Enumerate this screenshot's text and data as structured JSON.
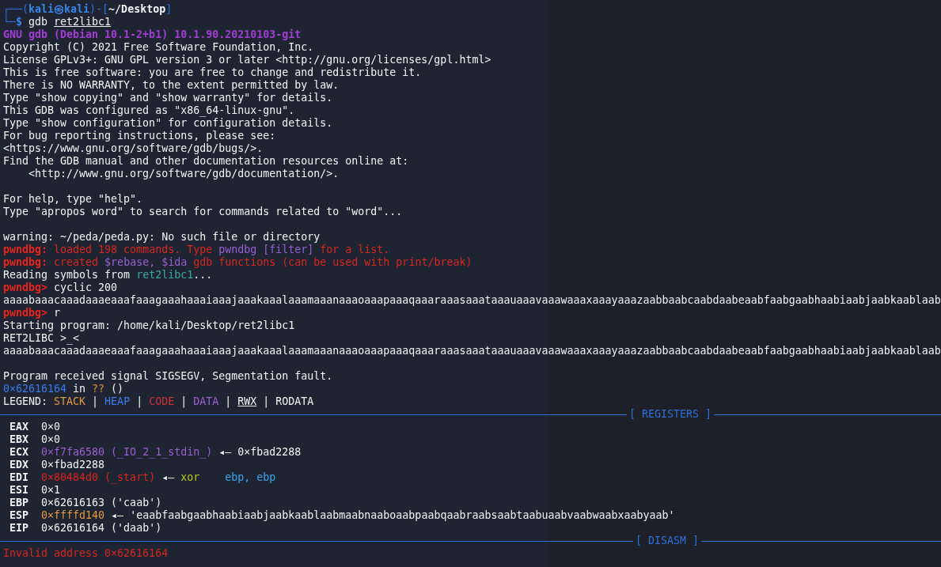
{
  "terminal": {
    "lines": [
      {
        "kind": "text",
        "segments": [
          {
            "text": "┌──(",
            "color": "#2f6fd6",
            "kind": "plain"
          },
          {
            "text": "kali㉿kali",
            "color": "#3a86e8",
            "kind": "bold"
          },
          {
            "text": ")-[",
            "color": "#2f6fd6",
            "kind": "plain"
          },
          {
            "text": "~/Desktop",
            "kind": "bold"
          },
          {
            "text": "]",
            "color": "#2f6fd6",
            "kind": "plain"
          }
        ]
      },
      {
        "kind": "text",
        "segments": [
          {
            "text": "└─",
            "color": "#2f6fd6",
            "kind": "plain"
          },
          {
            "text": "$",
            "color": "#3a86e8",
            "kind": "bold"
          },
          {
            "text": " gdb ",
            "kind": "plain"
          },
          {
            "text": "ret2libc1",
            "kind": "underlined"
          }
        ]
      },
      {
        "kind": "text",
        "segments": [
          {
            "text": "GNU gdb (Debian 10.1-2+b1) 10.1.90.20210103-git",
            "color": "#a13ed3",
            "kind": "bold"
          }
        ]
      },
      {
        "kind": "text",
        "segments": [
          {
            "text": "Copyright (C) 2021 Free Software Foundation, Inc.",
            "kind": "plain"
          }
        ]
      },
      {
        "kind": "text",
        "segments": [
          {
            "text": "License GPLv3+: GNU GPL version 3 or later <http://gnu.org/licenses/gpl.html>",
            "kind": "plain"
          }
        ]
      },
      {
        "kind": "text",
        "segments": [
          {
            "text": "This is free software: you are free to change and redistribute it.",
            "kind": "plain"
          }
        ]
      },
      {
        "kind": "text",
        "segments": [
          {
            "text": "There is NO WARRANTY, to the extent permitted by law.",
            "kind": "plain"
          }
        ]
      },
      {
        "kind": "text",
        "segments": [
          {
            "text": "Type \"show copying\" and \"show warranty\" for details.",
            "kind": "plain"
          }
        ]
      },
      {
        "kind": "text",
        "segments": [
          {
            "text": "This GDB was configured as \"x86_64-linux-gnu\".",
            "kind": "plain"
          }
        ]
      },
      {
        "kind": "text",
        "segments": [
          {
            "text": "Type \"show configuration\" for configuration details.",
            "kind": "plain"
          }
        ]
      },
      {
        "kind": "text",
        "segments": [
          {
            "text": "For bug reporting instructions, please see:",
            "kind": "plain"
          }
        ]
      },
      {
        "kind": "text",
        "segments": [
          {
            "text": "<https://www.gnu.org/software/gdb/bugs/>.",
            "kind": "plain"
          }
        ]
      },
      {
        "kind": "text",
        "segments": [
          {
            "text": "Find the GDB manual and other documentation resources online at:",
            "kind": "plain"
          }
        ]
      },
      {
        "kind": "text",
        "segments": [
          {
            "text": "    <http://www.gnu.org/software/gdb/documentation/>.",
            "kind": "plain"
          }
        ]
      },
      {
        "kind": "blank"
      },
      {
        "kind": "text",
        "segments": [
          {
            "text": "For help, type \"help\".",
            "kind": "plain"
          }
        ]
      },
      {
        "kind": "text",
        "segments": [
          {
            "text": "Type \"apropos word\" to search for commands related to \"word\"...",
            "kind": "plain"
          }
        ]
      },
      {
        "kind": "blank"
      },
      {
        "kind": "text",
        "segments": [
          {
            "text": "warning: ~/peda/peda.py: No such file or directory",
            "kind": "plain"
          }
        ]
      },
      {
        "kind": "text",
        "segments": [
          {
            "text": "pwndbg:",
            "color": "#e5251d",
            "kind": "bold"
          },
          {
            "text": " loaded 198 commands. Type ",
            "color": "#d8261f",
            "kind": "plain"
          },
          {
            "text": "pwndbg [filter]",
            "color": "#9a5fd0",
            "kind": "plain"
          },
          {
            "text": " for a list.",
            "color": "#d8261f",
            "kind": "plain"
          }
        ]
      },
      {
        "kind": "text",
        "segments": [
          {
            "text": "pwndbg:",
            "color": "#e5251d",
            "kind": "bold"
          },
          {
            "text": " created ",
            "color": "#d8261f",
            "kind": "plain"
          },
          {
            "text": "$rebase, $ida",
            "color": "#9a5fd0",
            "kind": "plain"
          },
          {
            "text": " gdb functions (can be used with print/break)",
            "color": "#d8261f",
            "kind": "plain"
          }
        ]
      },
      {
        "kind": "text",
        "segments": [
          {
            "text": "Reading symbols from ",
            "kind": "plain"
          },
          {
            "text": "ret2libc1",
            "color": "#3aa89e",
            "kind": "plain"
          },
          {
            "text": "...",
            "kind": "plain"
          }
        ]
      },
      {
        "kind": "text",
        "segments": [
          {
            "text": "pwndbg>",
            "color": "#e5251d",
            "kind": "bold"
          },
          {
            "text": " cyclic 200",
            "kind": "plain"
          }
        ]
      },
      {
        "kind": "text",
        "segments": [
          {
            "text": "aaaabaaacaaadaaaeaaafaaagaaahaaaiaaajaaakaaalaaamaaanaaaoaaapaaaqaaaraaasaaataaauaaavaaawaaaxaaayaaazaabbaabcaabdaabeaabfaabgaabhaabiaabjaabkaablaab",
            "kind": "plain"
          }
        ]
      },
      {
        "kind": "text",
        "segments": [
          {
            "text": "pwndbg>",
            "color": "#e5251d",
            "kind": "bold"
          },
          {
            "text": " r",
            "kind": "plain"
          }
        ]
      },
      {
        "kind": "text",
        "segments": [
          {
            "text": "Starting program: /home/kali/Desktop/ret2libc1",
            "kind": "plain"
          }
        ]
      },
      {
        "kind": "text",
        "segments": [
          {
            "text": "RET2LIBC >_<",
            "kind": "plain"
          }
        ]
      },
      {
        "kind": "text",
        "segments": [
          {
            "text": "aaaabaaacaaadaaaeaaafaaagaaahaaaiaaajaaakaaalaaamaaanaaaoaaapaaaqaaaraaasaaataaauaaavaaawaaaxaaayaaazaabbaabcaabdaabeaabfaabgaabhaabiaabjaabkaablaab",
            "kind": "plain"
          }
        ]
      },
      {
        "kind": "blank"
      },
      {
        "kind": "text",
        "segments": [
          {
            "text": "Program received signal SIGSEGV, Segmentation fault.",
            "kind": "plain"
          }
        ]
      },
      {
        "kind": "text",
        "segments": [
          {
            "text": "0×62616164",
            "color": "#3b7be8",
            "kind": "plain"
          },
          {
            "text": " in ",
            "kind": "plain"
          },
          {
            "text": "??",
            "color": "#d9912f",
            "kind": "plain"
          },
          {
            "text": " ()",
            "kind": "plain"
          }
        ]
      },
      {
        "kind": "text",
        "segments": [
          {
            "text": "LEGEND: ",
            "kind": "plain"
          },
          {
            "text": "STACK",
            "color": "#e39a3b",
            "kind": "plain"
          },
          {
            "text": " | ",
            "kind": "plain"
          },
          {
            "text": "HEAP",
            "color": "#3b7be8",
            "kind": "plain"
          },
          {
            "text": " | ",
            "kind": "plain"
          },
          {
            "text": "CODE",
            "color": "#cc3333",
            "kind": "plain"
          },
          {
            "text": " | ",
            "kind": "plain"
          },
          {
            "text": "DATA",
            "color": "#9a5fd0",
            "kind": "plain"
          },
          {
            "text": " | ",
            "kind": "plain"
          },
          {
            "text": "RWX",
            "kind": "underlined"
          },
          {
            "text": " | RODATA",
            "kind": "plain"
          }
        ]
      },
      {
        "kind": "separator",
        "label": "[ REGISTERS ]"
      },
      {
        "kind": "text",
        "segments": [
          {
            "text": " EAX  ",
            "kind": "bold"
          },
          {
            "text": "0×0",
            "kind": "plain"
          }
        ]
      },
      {
        "kind": "text",
        "segments": [
          {
            "text": " EBX  ",
            "kind": "bold"
          },
          {
            "text": "0×0",
            "kind": "plain"
          }
        ]
      },
      {
        "kind": "text",
        "segments": [
          {
            "text": " ECX  ",
            "kind": "bold"
          },
          {
            "text": "0×f7fa6580 (_IO_2_1_stdin_)",
            "color": "#9a5fd0",
            "kind": "plain"
          },
          {
            "text": " ◂— 0×fbad2288",
            "kind": "plain"
          }
        ]
      },
      {
        "kind": "text",
        "segments": [
          {
            "text": " EDX  ",
            "kind": "bold"
          },
          {
            "text": "0×fbad2288",
            "kind": "plain"
          }
        ]
      },
      {
        "kind": "text",
        "segments": [
          {
            "text": " EDI  ",
            "kind": "bold"
          },
          {
            "text": "0×80484d0 (_start)",
            "color": "#d8261f",
            "kind": "plain"
          },
          {
            "text": " ◂— ",
            "kind": "plain"
          },
          {
            "text": "xor    ",
            "color": "#b8c826",
            "kind": "plain"
          },
          {
            "text": "ebp, ebp",
            "color": "#3ca6ea",
            "kind": "plain"
          }
        ]
      },
      {
        "kind": "text",
        "segments": [
          {
            "text": " ESI  ",
            "kind": "bold"
          },
          {
            "text": "0×1",
            "kind": "plain"
          }
        ]
      },
      {
        "kind": "text",
        "segments": [
          {
            "text": " EBP  ",
            "kind": "bold"
          },
          {
            "text": "0×62616163 ('caab')",
            "kind": "plain"
          }
        ]
      },
      {
        "kind": "text",
        "segments": [
          {
            "text": " ESP  ",
            "kind": "bold"
          },
          {
            "text": "0×ffffd140",
            "color": "#e39a3b",
            "kind": "plain"
          },
          {
            "text": " ◂— 'eaabfaabgaabhaabiaabjaabkaablaabmaabnaaboaabpaabqaabraabsaabtaabuaabvaabwaabxaabyaab'",
            "kind": "plain"
          }
        ]
      },
      {
        "kind": "text",
        "segments": [
          {
            "text": " EIP  ",
            "kind": "bold"
          },
          {
            "text": "0×62616164 ('daab')",
            "kind": "plain"
          }
        ]
      },
      {
        "kind": "separator",
        "label": "[ DISASM ]"
      },
      {
        "kind": "text",
        "segments": [
          {
            "text": "Invalid address 0×62616164",
            "color": "#d8261f",
            "kind": "plain"
          }
        ]
      }
    ]
  }
}
